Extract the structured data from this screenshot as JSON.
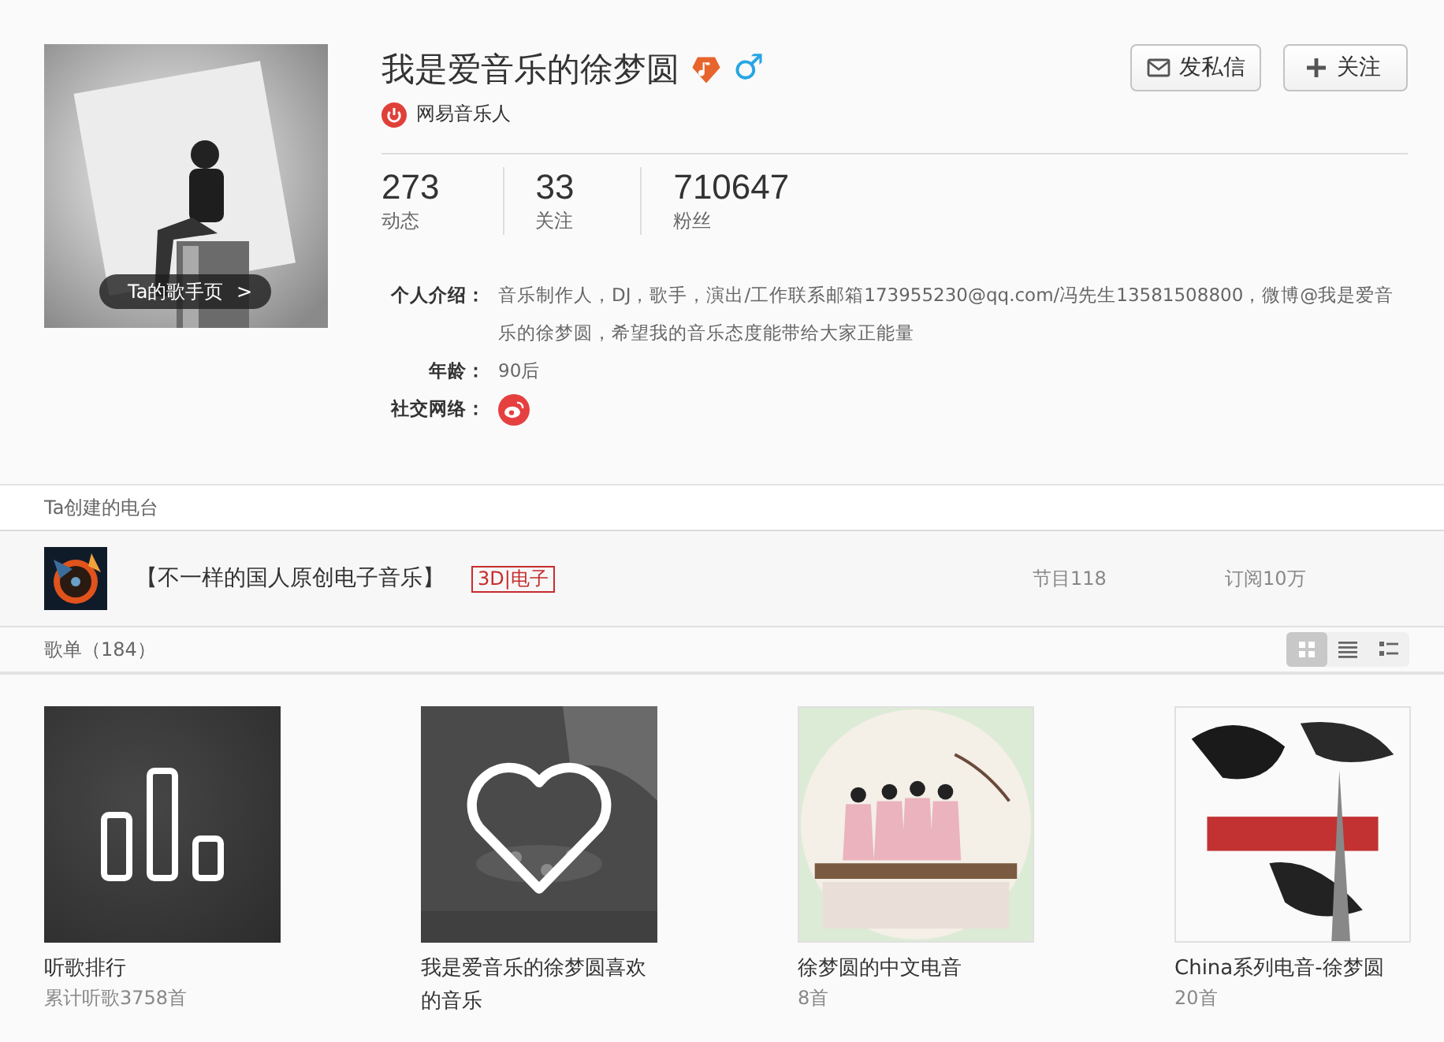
{
  "profile": {
    "name": "我是爱音乐的徐梦圆",
    "gender_symbol": "♂",
    "badge": "网易音乐人",
    "avatar_link": "Ta的歌手页",
    "avatar_arrow": ">",
    "buttons": [
      {
        "kind": "message",
        "label": "发私信"
      },
      {
        "kind": "follow",
        "label": "关注"
      }
    ],
    "stats": [
      {
        "value": "273",
        "label": "动态"
      },
      {
        "value": "33",
        "label": "关注"
      },
      {
        "value": "710647",
        "label": "粉丝"
      }
    ],
    "details": [
      {
        "kind": "text",
        "label": "个人介绍：",
        "value": "音乐制作人，DJ，歌手，演出/工作联系邮箱173955230@qq.com/冯先生13581508800，微博@我是爱音乐的徐梦圆，希望我的音乐态度能带给大家正能量"
      },
      {
        "kind": "text",
        "label": "年龄：",
        "value": "90后"
      },
      {
        "kind": "social",
        "label": "社交网络："
      }
    ]
  },
  "radio_section": {
    "title": "Ta创建的电台",
    "stations": [
      {
        "name": "【不一样的国人原创电子音乐】",
        "tag": "3D|电子",
        "programs": "节目118",
        "subscribers": "订阅10万"
      }
    ]
  },
  "playlist_section": {
    "title": "歌单（184）",
    "view_modes": [
      {
        "kind": "grid",
        "selected": true
      },
      {
        "kind": "list",
        "selected": false
      },
      {
        "kind": "detail",
        "selected": false
      }
    ],
    "playlists": [
      {
        "kind": "ranking",
        "title": "听歌排行",
        "subtitle": "累计听歌3758首"
      },
      {
        "kind": "liked",
        "title": "我是爱音乐的徐梦圆喜欢的音乐"
      },
      {
        "kind": "picture",
        "title": "徐梦圆的中文电音",
        "subtitle": "8首"
      },
      {
        "kind": "picture",
        "title": "China系列电音-徐梦圆",
        "subtitle": "20首"
      }
    ]
  }
}
